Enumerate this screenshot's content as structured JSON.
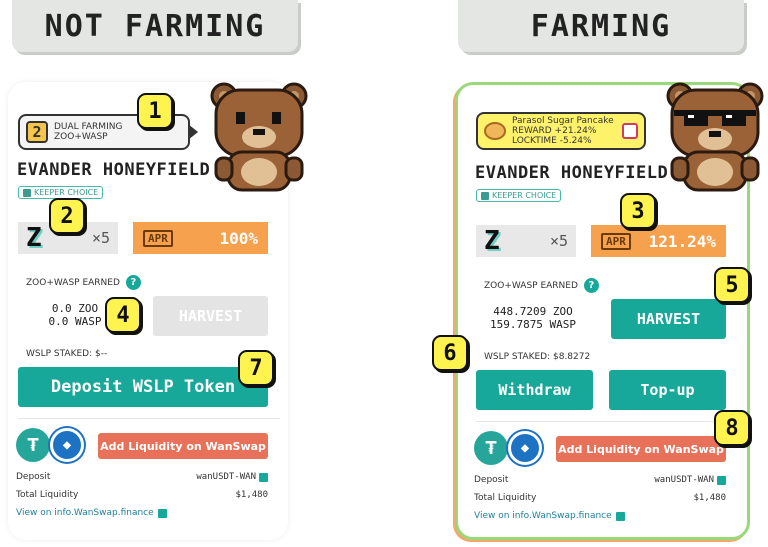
{
  "colors": {
    "teal": "#17a89a",
    "orange_apr": "#f5a14d",
    "orange_button": "#e8715a",
    "marker_yellow": "#fff44f",
    "farming_border": "#9ad97a"
  },
  "left": {
    "title": "NOT FARMING",
    "dual_farming_badge": "2",
    "dual_farming_line1": "DUAL FARMING",
    "dual_farming_line2": "ZOO+WASP",
    "name": "EVANDER HONEYFIELD",
    "keeper_choice": "KEEPER CHOICE",
    "multiplier_icon": "Z",
    "multiplier": "×5",
    "apr_tag": "APR",
    "apr": "100%",
    "earned_label": "ZOO+WASP EARNED",
    "help_icon": "?",
    "zoo_amount": "0.0 ZOO",
    "wasp_amount": "0.0 WASP",
    "harvest": "HARVEST",
    "staked": "WSLP STAKED: $--",
    "deposit": "Deposit WSLP Token",
    "add_liquidity": "Add Liquidity on WanSwap",
    "deposit_label": "Deposit",
    "deposit_value": "wanUSDT-WAN",
    "total_liquidity_label": "Total Liquidity",
    "total_liquidity_value": "$1,480",
    "view_link": "View on info.WanSwap.finance",
    "markers": [
      "1",
      "2",
      "4",
      "7"
    ]
  },
  "right": {
    "title": "FARMING",
    "boost_name": "Parasol Sugar Pancake",
    "boost_reward": "REWARD +21.24%",
    "boost_locktime": "LOCKTIME -5.24%",
    "name": "EVANDER HONEYFIELD",
    "keeper_choice": "KEEPER CHOICE",
    "multiplier_icon": "Z",
    "multiplier": "×5",
    "apr_tag": "APR",
    "apr": "121.24%",
    "earned_label": "ZOO+WASP EARNED",
    "help_icon": "?",
    "zoo_amount": "448.7209 ZOO",
    "wasp_amount": "159.7875 WASP",
    "harvest": "HARVEST",
    "staked": "WSLP STAKED: $8.8272",
    "withdraw": "Withdraw",
    "topup": "Top-up",
    "add_liquidity": "Add Liquidity on WanSwap",
    "deposit_label": "Deposit",
    "deposit_value": "wanUSDT-WAN",
    "total_liquidity_label": "Total Liquidity",
    "total_liquidity_value": "$1,480",
    "view_link": "View on info.WanSwap.finance",
    "markers": [
      "3",
      "5",
      "6",
      "8"
    ]
  }
}
